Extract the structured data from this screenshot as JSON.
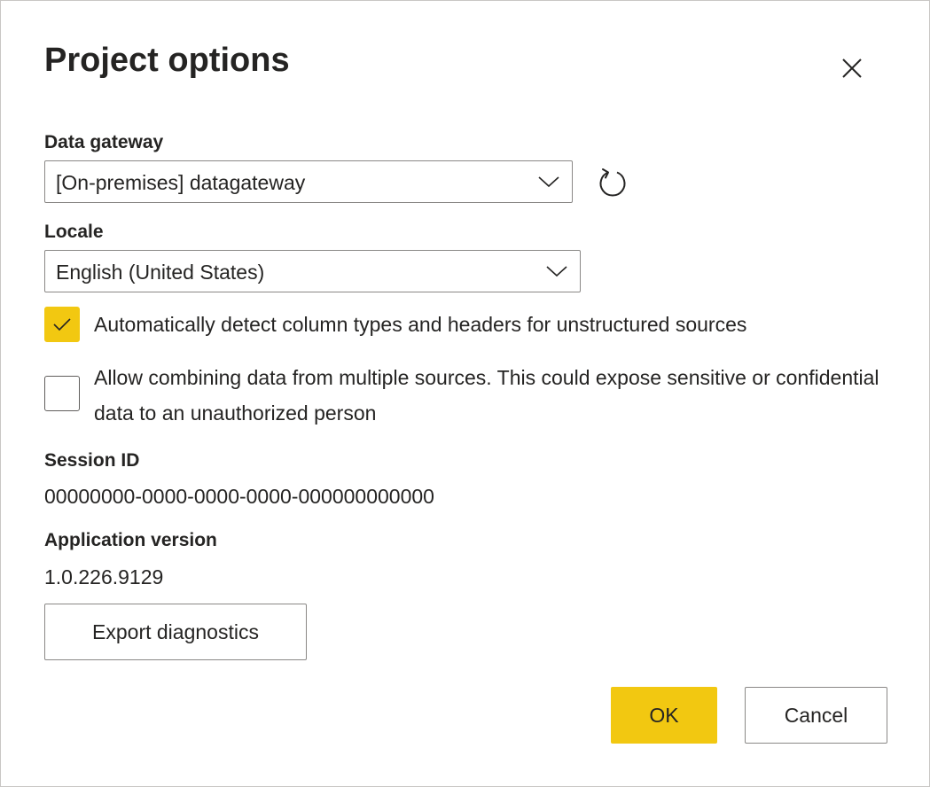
{
  "dialog": {
    "title": "Project options",
    "close_icon": "close-icon"
  },
  "gateway": {
    "label": "Data gateway",
    "value": "[On-premises] datagateway",
    "refresh_icon": "refresh-icon"
  },
  "locale": {
    "label": "Locale",
    "value": "English (United States)"
  },
  "options": {
    "auto_detect": {
      "label": "Automatically detect column types and headers for unstructured sources",
      "checked": true
    },
    "allow_combining": {
      "label": "Allow combining data from multiple sources. This could expose sensitive or confidential data to an unauthorized person",
      "checked": false
    }
  },
  "session": {
    "label": "Session ID",
    "value": "00000000-0000-0000-0000-000000000000"
  },
  "version": {
    "label": "Application version",
    "value": "1.0.226.9129"
  },
  "buttons": {
    "export_label": "Export diagnostics",
    "ok_label": "OK",
    "cancel_label": "Cancel"
  },
  "colors": {
    "accent": "#f2c811",
    "text": "#252423",
    "border": "#8a8886"
  }
}
